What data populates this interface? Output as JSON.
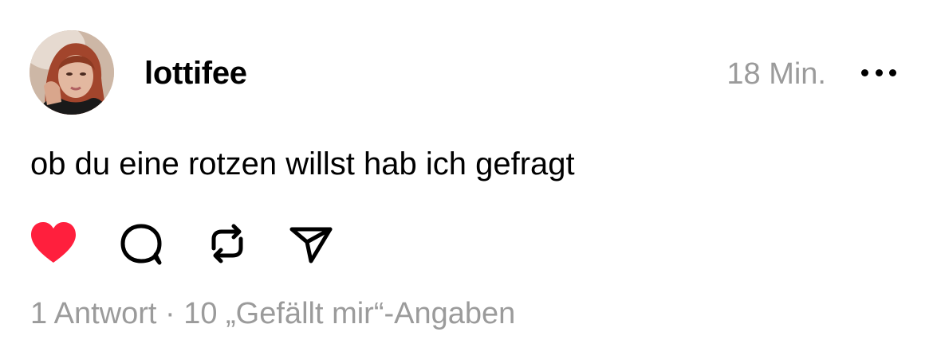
{
  "post": {
    "author": {
      "username": "lottifee",
      "avatar_icon": "profile-photo"
    },
    "timestamp": "18 Min.",
    "more_icon": "more-horizontal-icon",
    "text": "ob du eine rotzen willst hab ich gefragt",
    "actions": {
      "like": {
        "icon": "heart-icon",
        "liked": true,
        "color": "#ff3040"
      },
      "comment": {
        "icon": "comment-icon"
      },
      "repost": {
        "icon": "repost-icon"
      },
      "share": {
        "icon": "send-icon"
      }
    },
    "stats": {
      "replies": "1 Antwort",
      "separator": " · ",
      "likes": "10 „Gefällt mir“-Angaben"
    }
  }
}
